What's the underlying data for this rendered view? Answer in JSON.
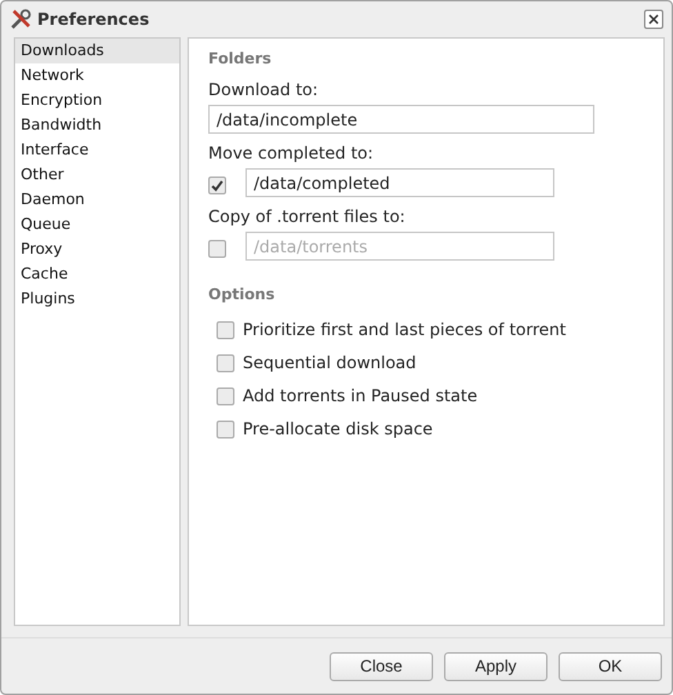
{
  "window": {
    "title": "Preferences"
  },
  "sidebar": {
    "items": [
      {
        "label": "Downloads",
        "selected": true
      },
      {
        "label": "Network",
        "selected": false
      },
      {
        "label": "Encryption",
        "selected": false
      },
      {
        "label": "Bandwidth",
        "selected": false
      },
      {
        "label": "Interface",
        "selected": false
      },
      {
        "label": "Other",
        "selected": false
      },
      {
        "label": "Daemon",
        "selected": false
      },
      {
        "label": "Queue",
        "selected": false
      },
      {
        "label": "Proxy",
        "selected": false
      },
      {
        "label": "Cache",
        "selected": false
      },
      {
        "label": "Plugins",
        "selected": false
      }
    ]
  },
  "folders": {
    "heading": "Folders",
    "fields": [
      {
        "label": "Download to:",
        "value": "/data/incomplete"
      },
      {
        "label": "Move completed to:",
        "checked": true,
        "value": "/data/completed",
        "disabled": false
      },
      {
        "label": "Copy of .torrent files to:",
        "checked": false,
        "value": "/data/torrents",
        "disabled": true
      }
    ]
  },
  "options": {
    "heading": "Options",
    "items": [
      {
        "label": "Prioritize first and last pieces of torrent",
        "checked": false
      },
      {
        "label": "Sequential download",
        "checked": false
      },
      {
        "label": "Add torrents in Paused state",
        "checked": false
      },
      {
        "label": "Pre-allocate disk space",
        "checked": false
      }
    ]
  },
  "buttons": [
    "Close",
    "Apply",
    "OK"
  ]
}
